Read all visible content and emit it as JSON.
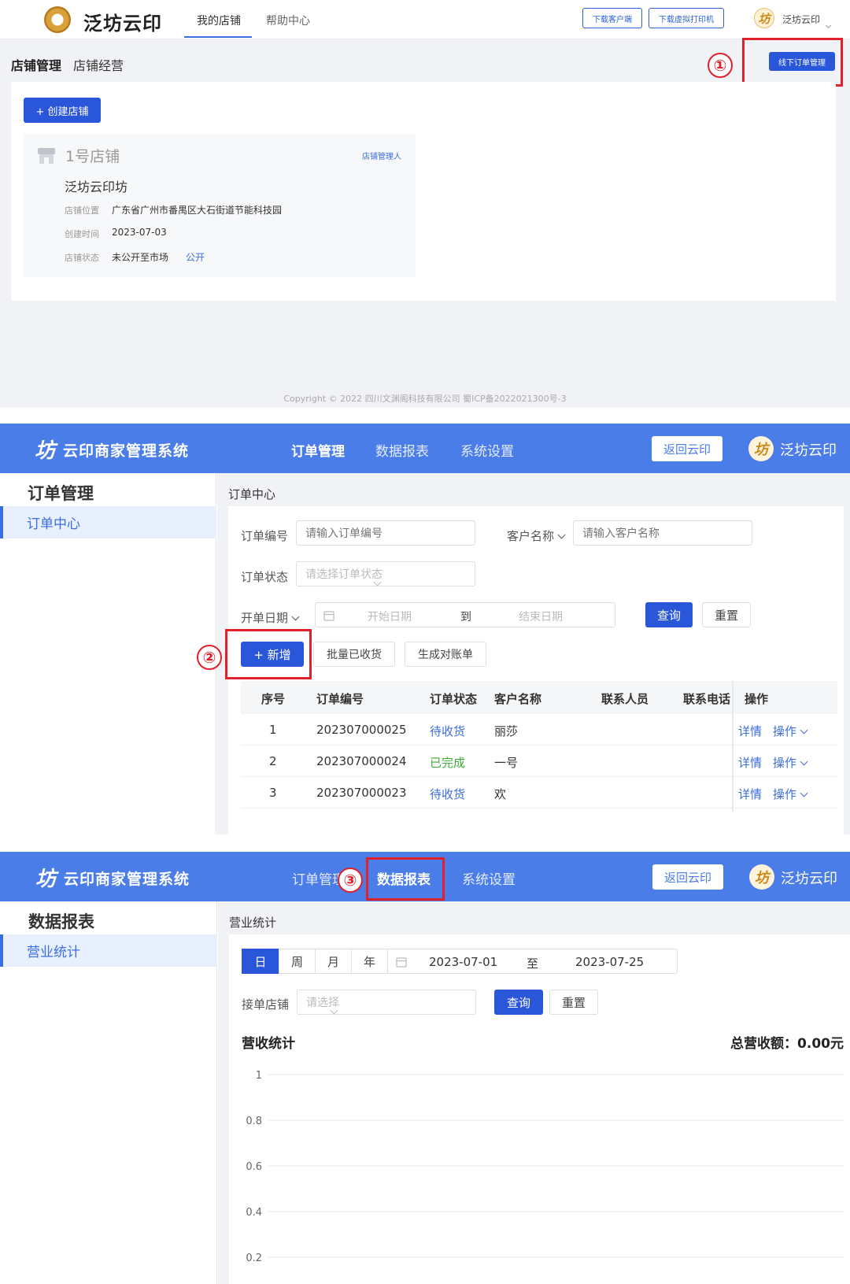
{
  "panel1": {
    "brand": "泛坊云印",
    "nav": [
      "我的店铺",
      "帮助中心"
    ],
    "download_client": "下载客户端",
    "download_printer": "下载虚拟打印机",
    "user_name": "泛坊云印",
    "sub_tabs": [
      "店铺管理",
      "店铺经营"
    ],
    "offline_order_button": "线下订单管理",
    "step_marker": "①",
    "create_store_button": "+ 创建店铺",
    "store_card": {
      "store_no": "1号店铺",
      "manager_link": "店铺管理人",
      "store_name": "泛坊云印坊",
      "location_label": "店铺位置",
      "location_value": "广东省广州市番禺区大石街道节能科技园",
      "created_label": "创建时间",
      "created_value": "2023-07-03",
      "status_label": "店铺状态",
      "status_value": "未公开至市场",
      "public_link": "公开"
    },
    "footer": "Copyright © 2022 四川文渊阁科技有限公司 蜀ICP备2022021300号-3"
  },
  "panel2": {
    "system_name": "云印商家管理系统",
    "nav": [
      "订单管理",
      "数据报表",
      "系统设置"
    ],
    "back_button": "返回云印",
    "user_name": "泛坊云印",
    "sidebar_title": "订单管理",
    "sidebar_item": "订单中心",
    "breadcrumb": "订单中心",
    "order_no_label": "订单编号",
    "order_no_placeholder": "请输入订单编号",
    "customer_label": "客户名称",
    "customer_placeholder": "请输入客户名称",
    "status_label": "订单状态",
    "status_placeholder": "请选择订单状态",
    "date_label": "开单日期",
    "date_start": "开始日期",
    "date_to": "到",
    "date_end": "结束日期",
    "query_button": "查询",
    "reset_button": "重置",
    "add_button": "+ 新增",
    "batch_received_button": "批量已收货",
    "statement_button": "生成对账单",
    "step_marker": "②",
    "columns": [
      "序号",
      "订单编号",
      "订单状态",
      "客户名称",
      "联系人员",
      "联系电话",
      "操作"
    ],
    "rows": [
      {
        "index": "1",
        "order_no": "202307000025",
        "status": "待收货",
        "status_type": "pending",
        "customer": "丽莎"
      },
      {
        "index": "2",
        "order_no": "202307000024",
        "status": "已完成",
        "status_type": "done",
        "customer": "一号"
      },
      {
        "index": "3",
        "order_no": "202307000023",
        "status": "待收货",
        "status_type": "pending",
        "customer": "欢"
      }
    ],
    "detail_link": "详情",
    "ops_link": "操作"
  },
  "panel3": {
    "system_name": "云印商家管理系统",
    "nav": [
      "订单管理",
      "数据报表",
      "系统设置"
    ],
    "back_button": "返回云印",
    "user_name": "泛坊云印",
    "step_marker": "③",
    "sidebar_title": "数据报表",
    "sidebar_item": "营业统计",
    "breadcrumb": "营业统计",
    "period_tabs": [
      "日",
      "周",
      "月",
      "年"
    ],
    "date_start": "2023-07-01",
    "date_to": "至",
    "date_end": "2023-07-25",
    "store_label": "接单店铺",
    "store_placeholder": "请选择",
    "query_button": "查询",
    "reset_button": "重置",
    "chart_heading": "营收统计",
    "total_revenue": "总营收额：0.00元"
  },
  "chart_data": {
    "type": "line",
    "title": "营收统计",
    "yticks": [
      "1",
      "0.8",
      "0.6",
      "0.4",
      "0.2"
    ],
    "ylim": [
      0,
      1
    ],
    "grid": true,
    "series": []
  },
  "colors": {
    "header_blue": "#4a7de8",
    "primary_button": "#2a56d9",
    "highlight_red": "#e0202a",
    "status_pending": "#3a6ee0",
    "status_done": "#3fab3a"
  }
}
